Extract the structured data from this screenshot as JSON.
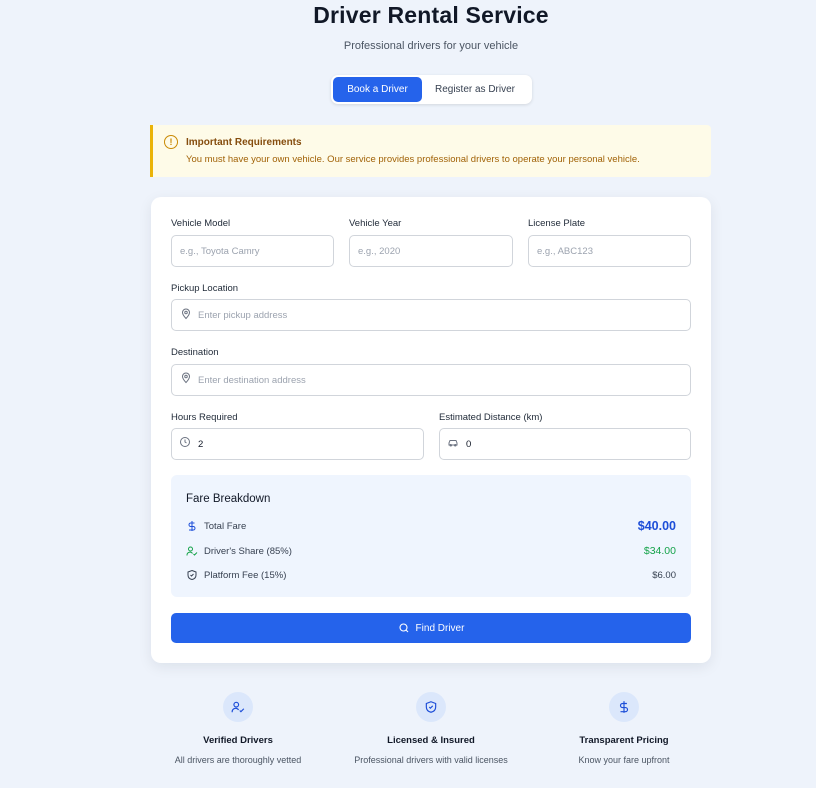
{
  "header": {
    "title": "Driver Rental Service",
    "subtitle": "Professional drivers for your vehicle"
  },
  "tabs": [
    {
      "label": "Book a Driver",
      "active": true
    },
    {
      "label": "Register as Driver",
      "active": false
    }
  ],
  "alert": {
    "icon": "alert-circle-icon",
    "title": "Important Requirements",
    "text": "You must have your own vehicle. Our service provides professional drivers to operate your personal vehicle."
  },
  "form": {
    "vehicle_model": {
      "label": "Vehicle Model",
      "placeholder": "e.g., Toyota Camry",
      "value": ""
    },
    "vehicle_year": {
      "label": "Vehicle Year",
      "placeholder": "e.g., 2020",
      "value": ""
    },
    "license_plate": {
      "label": "License Plate",
      "placeholder": "e.g., ABC123",
      "value": ""
    },
    "pickup": {
      "label": "Pickup Location",
      "placeholder": "Enter pickup address",
      "value": ""
    },
    "destination": {
      "label": "Destination",
      "placeholder": "Enter destination address",
      "value": ""
    },
    "hours": {
      "label": "Hours Required",
      "value": "2"
    },
    "distance": {
      "label": "Estimated Distance (km)",
      "value": "0"
    }
  },
  "fare": {
    "title": "Fare Breakdown",
    "total": {
      "label": "Total Fare",
      "value": "$40.00"
    },
    "driver_share": {
      "label": "Driver's Share (85%)",
      "value": "$34.00"
    },
    "platform_fee": {
      "label": "Platform Fee (15%)",
      "value": "$6.00"
    }
  },
  "find_button": {
    "label": "Find Driver"
  },
  "features": [
    {
      "icon": "user-check-icon",
      "title": "Verified Drivers",
      "desc": "All drivers are thoroughly vetted"
    },
    {
      "icon": "shield-check-icon",
      "title": "Licensed & Insured",
      "desc": "Professional drivers with valid licenses"
    },
    {
      "icon": "dollar-icon",
      "title": "Transparent Pricing",
      "desc": "Know your fare upfront"
    }
  ],
  "colors": {
    "primary": "#2563eb",
    "warning_border": "#eab308",
    "success": "#16a34a"
  }
}
